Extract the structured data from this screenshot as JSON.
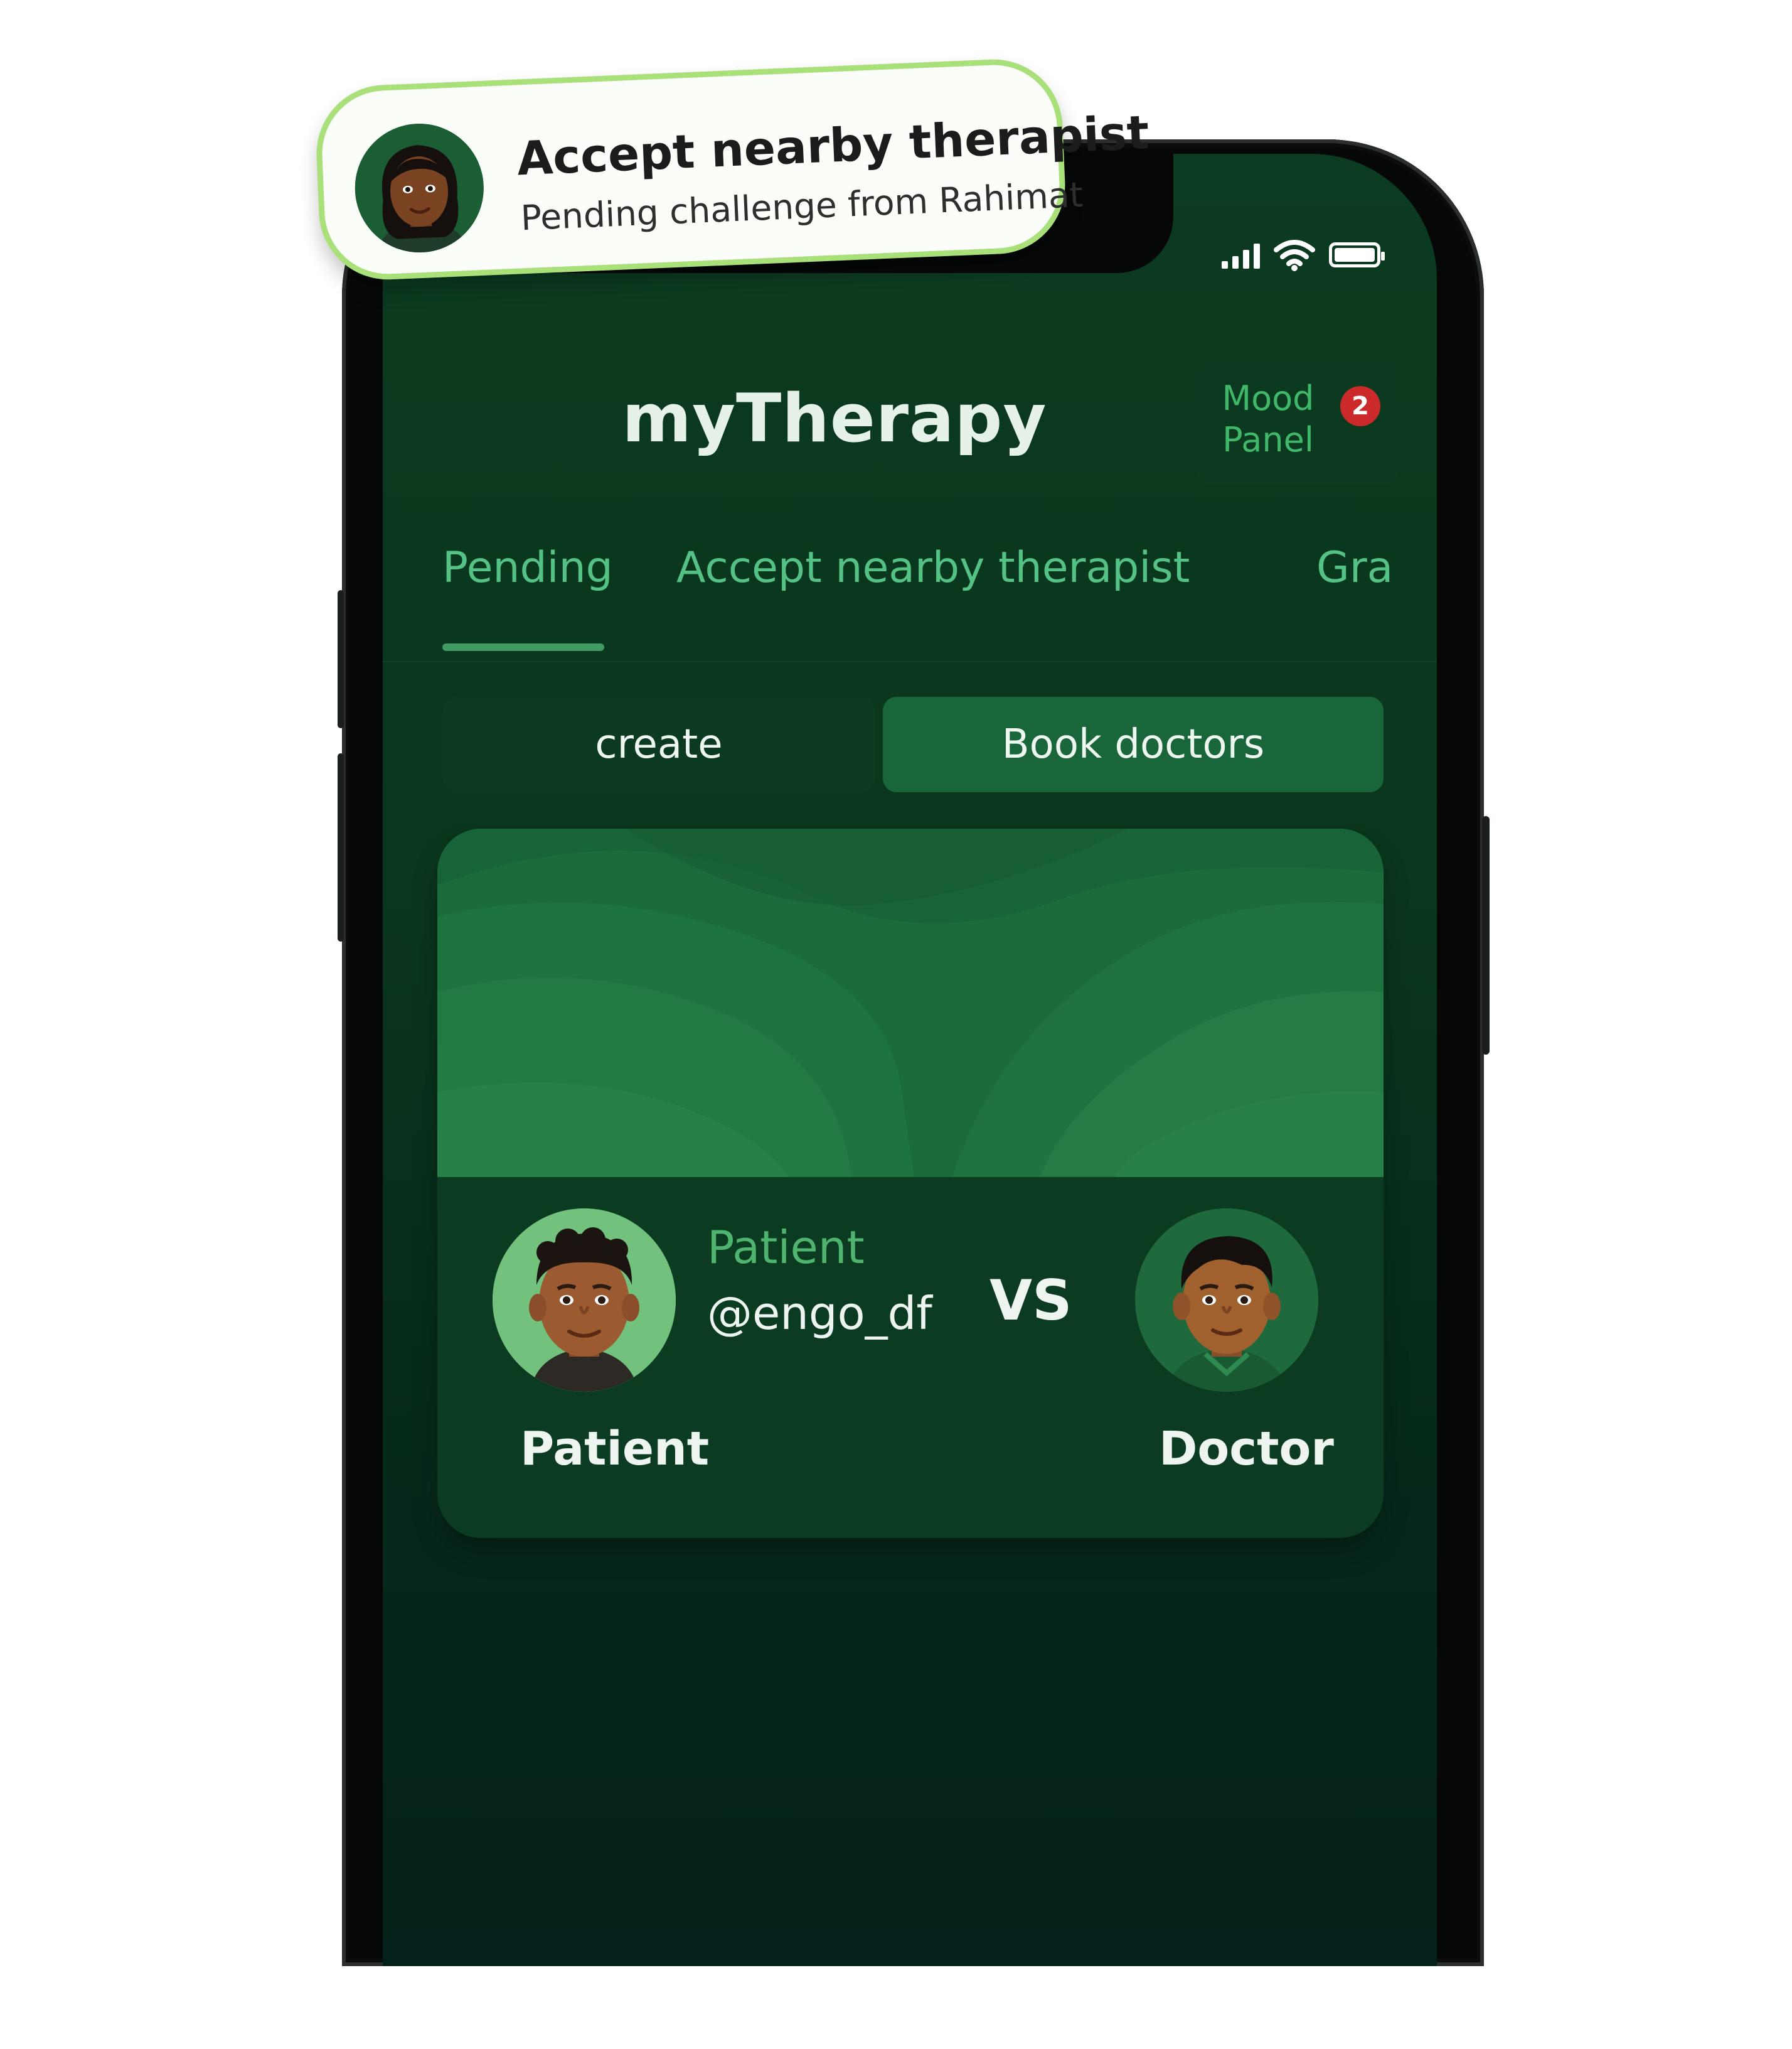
{
  "notification": {
    "title": "Accept nearby therapist",
    "subtitle": "Pending challenge from Rahimat"
  },
  "header": {
    "title": "myTherapy",
    "mood_panel": {
      "line1": "Mood",
      "line2": "Panel",
      "badge_count": "2"
    }
  },
  "tabs": [
    {
      "label": "Pending",
      "active": true
    },
    {
      "label": "Accept nearby therapist",
      "active": false
    },
    {
      "label": "Gra",
      "active": false
    }
  ],
  "segments": {
    "create": "create",
    "book": "Book doctors",
    "selected": "book"
  },
  "match_card": {
    "player_role": "Patient",
    "player_handle": "@engo_df",
    "vs": "VS",
    "left_label": "Patient",
    "right_label": "Doctor"
  },
  "status_bar": {
    "icons": [
      "signal-icon",
      "wifi-icon",
      "battery-icon"
    ]
  },
  "colors": {
    "screen_bg": "#0b3b20",
    "accent_green": "#54c284",
    "toast_border": "#a9e07a",
    "badge_red": "#cc2a2a"
  }
}
